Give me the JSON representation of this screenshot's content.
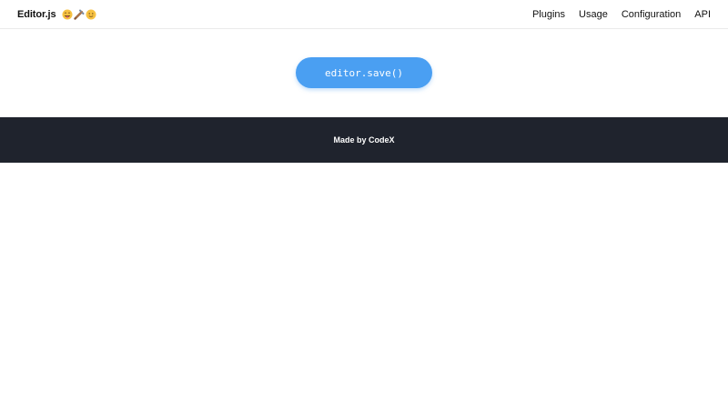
{
  "header": {
    "logo_text": "Editor.js",
    "logo_emojis": [
      "face-with-tongue-icon",
      "tools-icon",
      "smiling-face-icon"
    ],
    "nav": [
      {
        "label": "Plugins"
      },
      {
        "label": "Usage"
      },
      {
        "label": "Configuration"
      },
      {
        "label": "API"
      }
    ]
  },
  "main": {
    "save_button_label": "editor.save()"
  },
  "footer": {
    "text": "Made by CodeX"
  },
  "colors": {
    "accent": "#4a9ff2",
    "footer_bg": "#1f232d",
    "text": "#111111"
  }
}
